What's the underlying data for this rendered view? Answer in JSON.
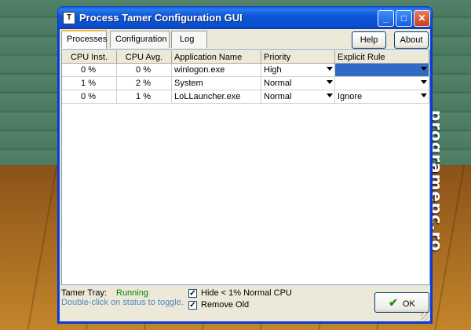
{
  "window": {
    "title": "Process Tamer Configuration GUI",
    "icon": "process-tamer-icon"
  },
  "tabs": [
    {
      "label": "Processes",
      "active": true
    },
    {
      "label": "Configuration"
    },
    {
      "label": "Log"
    }
  ],
  "toolbar": {
    "help_label": "Help",
    "about_label": "About"
  },
  "table": {
    "columns": [
      "CPU Inst.",
      "CPU Avg.",
      "Application Name",
      "Priority",
      "Explicit Rule"
    ],
    "rows": [
      {
        "cpu_inst": "0 %",
        "cpu_avg": "0 %",
        "app": "winlogon.exe",
        "priority": "High",
        "rule": ""
      },
      {
        "cpu_inst": "1 %",
        "cpu_avg": "2 %",
        "app": "System",
        "priority": "Normal",
        "rule": ""
      },
      {
        "cpu_inst": "0 %",
        "cpu_avg": "1 %",
        "app": "LoLLauncher.exe",
        "priority": "Normal",
        "rule": "Ignore"
      }
    ]
  },
  "status": {
    "tray_label": "Tamer Tray:",
    "tray_value": "Running",
    "hint": "Double-click on status to toggle.",
    "hide_label": "Hide < 1% Normal CPU",
    "remove_old_label": "Remove Old",
    "ok_label": "OK"
  },
  "watermark": "programepc.ro",
  "colors": {
    "running": "#008000",
    "hint": "#4f86c6",
    "selection": "#316ac5"
  }
}
